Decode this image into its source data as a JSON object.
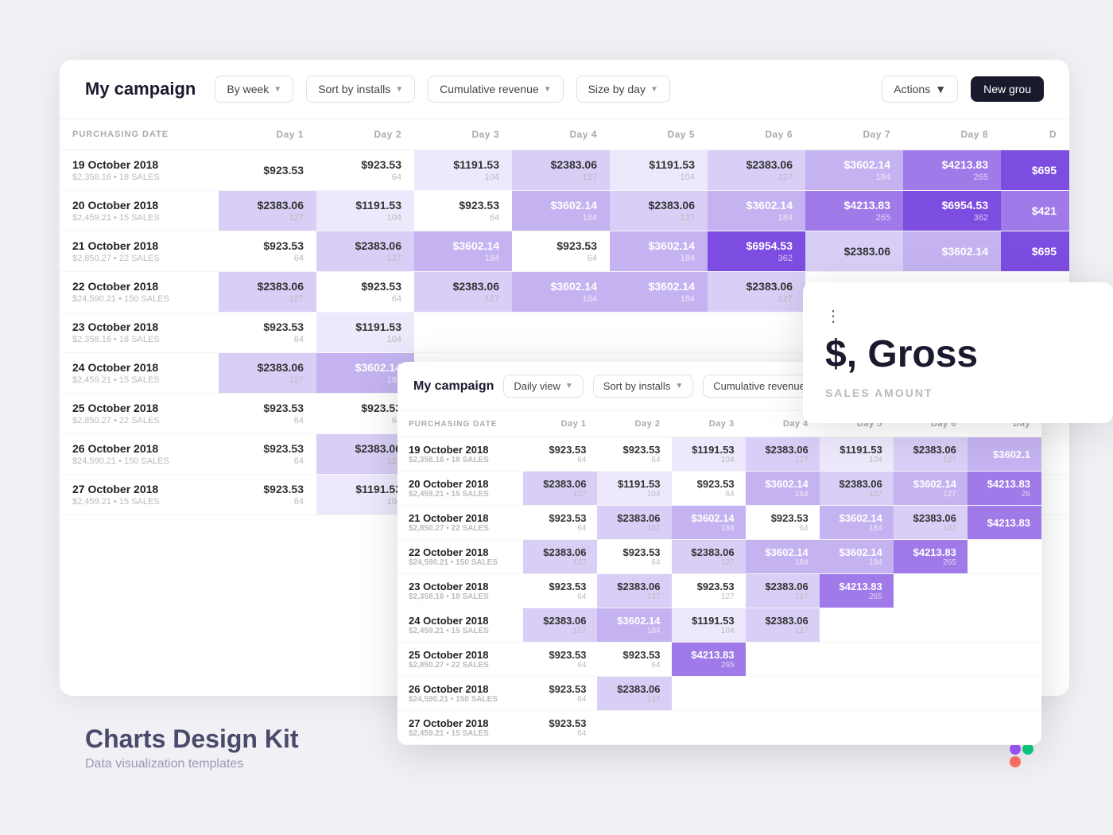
{
  "header": {
    "title": "My campaign",
    "filter1": "By week",
    "filter2": "Sort by installs",
    "filter3": "Cumulative revenue",
    "filter4": "Size by day",
    "actions": "Actions",
    "new_group": "New grou"
  },
  "columns": {
    "date_header": "PURCHASING DATE",
    "days": [
      "Day 1",
      "Day 2",
      "Day 3",
      "Day 4",
      "Day 5",
      "Day 6",
      "Day 7",
      "Day 8",
      "D"
    ]
  },
  "rows": [
    {
      "date": "19 October 2018",
      "sub": "$2,358.16 • 18 SALES",
      "values": [
        {
          "amount": "$923.53",
          "count": "",
          "heat": 0
        },
        {
          "amount": "$923.53",
          "count": "64",
          "heat": 0
        },
        {
          "amount": "$1191.53",
          "count": "104",
          "heat": 1
        },
        {
          "amount": "$2383.06",
          "count": "127",
          "heat": 2
        },
        {
          "amount": "$1191.53",
          "count": "104",
          "heat": 1
        },
        {
          "amount": "$2383.06",
          "count": "127",
          "heat": 2
        },
        {
          "amount": "$3602.14",
          "count": "184",
          "heat": 3
        },
        {
          "amount": "$4213.83",
          "count": "265",
          "heat": 4
        },
        {
          "amount": "$695",
          "count": "",
          "heat": 5
        }
      ]
    },
    {
      "date": "20 October 2018",
      "sub": "$2,459.21 • 15 SALES",
      "values": [
        {
          "amount": "$2383.06",
          "count": "127",
          "heat": 2
        },
        {
          "amount": "$1191.53",
          "count": "104",
          "heat": 1
        },
        {
          "amount": "$923.53",
          "count": "64",
          "heat": 0
        },
        {
          "amount": "$3602.14",
          "count": "184",
          "heat": 3
        },
        {
          "amount": "$2383.06",
          "count": "127",
          "heat": 2
        },
        {
          "amount": "$3602.14",
          "count": "184",
          "heat": 3
        },
        {
          "amount": "$4213.83",
          "count": "265",
          "heat": 4
        },
        {
          "amount": "$6954.53",
          "count": "362",
          "heat": 5
        },
        {
          "amount": "$421",
          "count": "",
          "heat": 4
        }
      ]
    },
    {
      "date": "21 October 2018",
      "sub": "$2,850.27 • 22 SALES",
      "values": [
        {
          "amount": "$923.53",
          "count": "64",
          "heat": 0
        },
        {
          "amount": "$2383.06",
          "count": "127",
          "heat": 2
        },
        {
          "amount": "$3602.14",
          "count": "184",
          "heat": 3
        },
        {
          "amount": "$923.53",
          "count": "64",
          "heat": 0
        },
        {
          "amount": "$3602.14",
          "count": "184",
          "heat": 3
        },
        {
          "amount": "$6954.53",
          "count": "362",
          "heat": 5
        },
        {
          "amount": "$2383.06",
          "count": "",
          "heat": 2
        },
        {
          "amount": "$3602.14",
          "count": "",
          "heat": 3
        },
        {
          "amount": "$695",
          "count": "",
          "heat": 5
        }
      ]
    },
    {
      "date": "22 October 2018",
      "sub": "$24,590.21 • 150 SALES",
      "values": [
        {
          "amount": "$2383.06",
          "count": "127",
          "heat": 2
        },
        {
          "amount": "$923.53",
          "count": "64",
          "heat": 0
        },
        {
          "amount": "$2383.06",
          "count": "127",
          "heat": 2
        },
        {
          "amount": "$3602.14",
          "count": "184",
          "heat": 3
        },
        {
          "amount": "$3602.14",
          "count": "184",
          "heat": 3
        },
        {
          "amount": "$2383.06",
          "count": "127",
          "heat": 2
        },
        {
          "amount": "$",
          "count": "",
          "heat": 0
        },
        {
          "amount": "",
          "count": "",
          "heat": 0
        },
        {
          "amount": "",
          "count": "",
          "heat": 0
        }
      ]
    },
    {
      "date": "23 October 2018",
      "sub": "$2,358.16 • 18 SALES",
      "values": [
        {
          "amount": "$923.53",
          "count": "64",
          "heat": 0
        },
        {
          "amount": "$1191.53",
          "count": "104",
          "heat": 1
        },
        {
          "amount": "",
          "count": "",
          "heat": 0
        },
        {
          "amount": "",
          "count": "",
          "heat": 0
        },
        {
          "amount": "",
          "count": "",
          "heat": 0
        },
        {
          "amount": "",
          "count": "",
          "heat": 0
        },
        {
          "amount": "",
          "count": "",
          "heat": 0
        },
        {
          "amount": "",
          "count": "",
          "heat": 0
        },
        {
          "amount": "",
          "count": "",
          "heat": 0
        }
      ]
    },
    {
      "date": "24 October 2018",
      "sub": "$2,459.21 • 15 SALES",
      "values": [
        {
          "amount": "$2383.06",
          "count": "127",
          "heat": 2
        },
        {
          "amount": "$3602.14",
          "count": "184",
          "heat": 3
        },
        {
          "amount": "",
          "count": "",
          "heat": 0
        },
        {
          "amount": "",
          "count": "",
          "heat": 0
        },
        {
          "amount": "",
          "count": "",
          "heat": 0
        },
        {
          "amount": "",
          "count": "",
          "heat": 0
        },
        {
          "amount": "",
          "count": "",
          "heat": 0
        },
        {
          "amount": "",
          "count": "",
          "heat": 0
        },
        {
          "amount": "",
          "count": "",
          "heat": 0
        }
      ]
    },
    {
      "date": "25 October 2018",
      "sub": "$2,850.27 • 22 SALES",
      "values": [
        {
          "amount": "$923.53",
          "count": "64",
          "heat": 0
        },
        {
          "amount": "$923.53",
          "count": "64",
          "heat": 0
        },
        {
          "amount": "",
          "count": "",
          "heat": 0
        },
        {
          "amount": "",
          "count": "",
          "heat": 0
        },
        {
          "amount": "",
          "count": "",
          "heat": 0
        },
        {
          "amount": "",
          "count": "",
          "heat": 0
        },
        {
          "amount": "",
          "count": "",
          "heat": 0
        },
        {
          "amount": "",
          "count": "",
          "heat": 0
        },
        {
          "amount": "",
          "count": "",
          "heat": 0
        }
      ]
    },
    {
      "date": "26 October 2018",
      "sub": "$24,590.21 • 150 SALES",
      "values": [
        {
          "amount": "$923.53",
          "count": "64",
          "heat": 0
        },
        {
          "amount": "$2383.06",
          "count": "127",
          "heat": 2
        },
        {
          "amount": "",
          "count": "",
          "heat": 0
        },
        {
          "amount": "",
          "count": "",
          "heat": 0
        },
        {
          "amount": "",
          "count": "",
          "heat": 0
        },
        {
          "amount": "",
          "count": "",
          "heat": 0
        },
        {
          "amount": "",
          "count": "",
          "heat": 0
        },
        {
          "amount": "",
          "count": "",
          "heat": 0
        },
        {
          "amount": "",
          "count": "",
          "heat": 0
        }
      ]
    },
    {
      "date": "27 October 2018",
      "sub": "$2,459.21 • 15 SALES",
      "values": [
        {
          "amount": "$923.53",
          "count": "64",
          "heat": 0
        },
        {
          "amount": "$1191.53",
          "count": "104",
          "heat": 1
        },
        {
          "amount": "",
          "count": "",
          "heat": 0
        },
        {
          "amount": "",
          "count": "",
          "heat": 0
        },
        {
          "amount": "",
          "count": "",
          "heat": 0
        },
        {
          "amount": "",
          "count": "",
          "heat": 0
        },
        {
          "amount": "",
          "count": "",
          "heat": 0
        },
        {
          "amount": "",
          "count": "",
          "heat": 0
        },
        {
          "amount": "",
          "count": "",
          "heat": 0
        }
      ]
    }
  ],
  "popup": {
    "title": "My campaign",
    "filter1": "Daily view",
    "filter2": "Sort by installs",
    "filter3": "Cumulative revenue",
    "date_header": "PURCHASING DATE",
    "days": [
      "Day 1",
      "Day 2",
      "Day 3",
      "Day 4",
      "Day 5",
      "Day 6",
      "Day"
    ],
    "rows": [
      {
        "date": "19 October 2018",
        "sub": "$2,358.16 • 18 SALES",
        "values": [
          {
            "amount": "$923.53",
            "count": "64",
            "heat": 0
          },
          {
            "amount": "$923.53",
            "count": "64",
            "heat": 0
          },
          {
            "amount": "$1191.53",
            "count": "104",
            "heat": 1
          },
          {
            "amount": "$2383.06",
            "count": "127",
            "heat": 2
          },
          {
            "amount": "$1191.53",
            "count": "104",
            "heat": 1
          },
          {
            "amount": "$2383.06",
            "count": "127",
            "heat": 2
          },
          {
            "amount": "$3602.1",
            "count": "",
            "heat": 3
          }
        ]
      },
      {
        "date": "20 October 2018",
        "sub": "$2,459.21 • 15 SALES",
        "values": [
          {
            "amount": "$2383.06",
            "count": "127",
            "heat": 2
          },
          {
            "amount": "$1191.53",
            "count": "104",
            "heat": 1
          },
          {
            "amount": "$923.53",
            "count": "64",
            "heat": 0
          },
          {
            "amount": "$3602.14",
            "count": "184",
            "heat": 3
          },
          {
            "amount": "$2383.06",
            "count": "127",
            "heat": 2
          },
          {
            "amount": "$3602.14",
            "count": "127",
            "heat": 3
          },
          {
            "amount": "$4213.83",
            "count": "26",
            "heat": 4
          }
        ]
      },
      {
        "date": "21 October 2018",
        "sub": "$2,850.27 • 22 SALES",
        "values": [
          {
            "amount": "$923.53",
            "count": "64",
            "heat": 0
          },
          {
            "amount": "$2383.06",
            "count": "127",
            "heat": 2
          },
          {
            "amount": "$3602.14",
            "count": "184",
            "heat": 3
          },
          {
            "amount": "$923.53",
            "count": "64",
            "heat": 0
          },
          {
            "amount": "$3602.14",
            "count": "184",
            "heat": 3
          },
          {
            "amount": "$2383.06",
            "count": "127",
            "heat": 2
          },
          {
            "amount": "$4213.83",
            "count": "",
            "heat": 4
          }
        ]
      },
      {
        "date": "22 October 2018",
        "sub": "$24,590.21 • 150 SALES",
        "values": [
          {
            "amount": "$2383.06",
            "count": "127",
            "heat": 2
          },
          {
            "amount": "$923.53",
            "count": "64",
            "heat": 0
          },
          {
            "amount": "$2383.06",
            "count": "127",
            "heat": 2
          },
          {
            "amount": "$3602.14",
            "count": "184",
            "heat": 3
          },
          {
            "amount": "$3602.14",
            "count": "184",
            "heat": 3
          },
          {
            "amount": "$4213.83",
            "count": "265",
            "heat": 4
          },
          {
            "amount": "",
            "count": "",
            "heat": 0
          }
        ]
      },
      {
        "date": "23 October 2018",
        "sub": "$2,358.16 • 18 SALES",
        "values": [
          {
            "amount": "$923.53",
            "count": "64",
            "heat": 0
          },
          {
            "amount": "$2383.06",
            "count": "127",
            "heat": 2
          },
          {
            "amount": "$923.53",
            "count": "127",
            "heat": 0
          },
          {
            "amount": "$2383.06",
            "count": "127",
            "heat": 2
          },
          {
            "amount": "$4213.83",
            "count": "265",
            "heat": 4
          },
          {
            "amount": "",
            "count": "",
            "heat": 0
          },
          {
            "amount": "",
            "count": "",
            "heat": 0
          }
        ]
      },
      {
        "date": "24 October 2018",
        "sub": "$2,459.21 • 15 SALES",
        "values": [
          {
            "amount": "$2383.06",
            "count": "127",
            "heat": 2
          },
          {
            "amount": "$3602.14",
            "count": "184",
            "heat": 3
          },
          {
            "amount": "$1191.53",
            "count": "104",
            "heat": 1
          },
          {
            "amount": "$2383.06",
            "count": "127",
            "heat": 2
          },
          {
            "amount": "",
            "count": "",
            "heat": 0
          },
          {
            "amount": "",
            "count": "",
            "heat": 0
          },
          {
            "amount": "",
            "count": "",
            "heat": 0
          }
        ]
      },
      {
        "date": "25 October 2018",
        "sub": "$2,850.27 • 22 SALES",
        "values": [
          {
            "amount": "$923.53",
            "count": "64",
            "heat": 0
          },
          {
            "amount": "$923.53",
            "count": "64",
            "heat": 0
          },
          {
            "amount": "$4213.83",
            "count": "265",
            "heat": 4
          },
          {
            "amount": "",
            "count": "",
            "heat": 0
          },
          {
            "amount": "",
            "count": "",
            "heat": 0
          },
          {
            "amount": "",
            "count": "",
            "heat": 0
          },
          {
            "amount": "",
            "count": "",
            "heat": 0
          }
        ]
      },
      {
        "date": "26 October 2018",
        "sub": "$24,590.21 • 150 SALES",
        "values": [
          {
            "amount": "$923.53",
            "count": "64",
            "heat": 0
          },
          {
            "amount": "$2383.06",
            "count": "127",
            "heat": 2
          },
          {
            "amount": "",
            "count": "",
            "heat": 0
          },
          {
            "amount": "",
            "count": "",
            "heat": 0
          },
          {
            "amount": "",
            "count": "",
            "heat": 0
          },
          {
            "amount": "",
            "count": "",
            "heat": 0
          },
          {
            "amount": "",
            "count": "",
            "heat": 0
          }
        ]
      },
      {
        "date": "27 October 2018",
        "sub": "$2,459.21 • 15 SALES",
        "values": [
          {
            "amount": "$923.53",
            "count": "64",
            "heat": 0
          },
          {
            "amount": "",
            "count": "",
            "heat": 0
          },
          {
            "amount": "",
            "count": "",
            "heat": 0
          },
          {
            "amount": "",
            "count": "",
            "heat": 0
          },
          {
            "amount": "",
            "count": "",
            "heat": 0
          },
          {
            "amount": "",
            "count": "",
            "heat": 0
          },
          {
            "amount": "",
            "count": "",
            "heat": 0
          }
        ]
      }
    ]
  },
  "gross_panel": {
    "dots": "⋮",
    "title": "$, Gross",
    "subtitle": "SALES AMOUNT"
  },
  "footer": {
    "title": "Charts Design Kit",
    "subtitle": "Data visualization templates"
  }
}
